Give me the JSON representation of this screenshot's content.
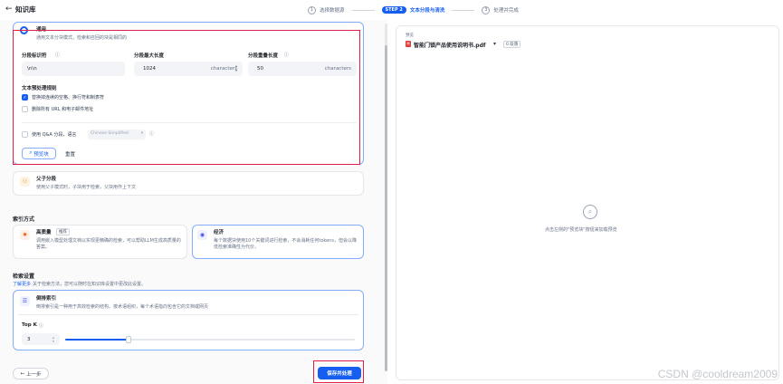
{
  "header": {
    "back_icon": "arrow-left-icon",
    "title": "知识库",
    "steps": [
      {
        "num": "1",
        "label": "选择数据源"
      },
      {
        "badge": "STEP 2",
        "label": "文本分段与清洗"
      },
      {
        "num": "3",
        "label": "处理并完成"
      }
    ]
  },
  "general_mode": {
    "title": "通用",
    "desc": "通用文本分块模式，检索和召回的块是相同的",
    "delimiter_label": "分段标识符",
    "delimiter_value": "\\n\\n",
    "max_len_label": "分段最大长度",
    "max_len_value": "1024",
    "max_len_unit": "characters",
    "overlap_label": "分段重叠长度",
    "overlap_value": "50",
    "overlap_unit": "characters",
    "preprocess_title": "文本预处理规则",
    "rule1": "替换掉连续的空格、换行符和制表符",
    "rule2": "删除所有 URL 和电子邮件地址",
    "qa_label": "使用 Q&A 分段，语言",
    "qa_lang": "Chinese Simplified",
    "preview_button": "预览块",
    "reset_button": "重置"
  },
  "parent_child": {
    "title": "父子分段",
    "desc": "使用父子模式时，子块用于检索，父块用作上下文"
  },
  "index_method": {
    "section_title": "索引方式",
    "high_quality_title": "高质量",
    "high_quality_badge": "推荐",
    "high_quality_desc": "调用嵌入模型处理文档以实现更精确的检索，可以帮助LLM生成高质量的答案。",
    "economy_title": "经济",
    "economy_desc": "每个数据块使用10个关键词进行检索，不会消耗任何tokens，但会以降低检索准确性为代价。"
  },
  "retrieval": {
    "section_title": "检索设置",
    "learn_more_link": "了解更多",
    "learn_more_rest": "关于检索方法，您可以随时在知识库设置中更改此设置。",
    "inverted_title": "倒排索引",
    "inverted_desc": "倒排索引是一种用于高效检索的结构。按术语组织，每个术语指向包含它的文档或网页",
    "topk_label": "Top K",
    "topk_value": "3",
    "topk_fraction": 0.22
  },
  "footer": {
    "prev_button": "上一步",
    "save_button": "保存并处理"
  },
  "preview": {
    "small_label": "预览",
    "file_name": "智能门锁产品使用说明书.pdf",
    "chunk_badge": "0 段落",
    "empty_text": "点击左侧的\"预览块\"按钮来加载预览"
  },
  "watermark": "CSDN @cooldream2009",
  "colors": {
    "accent": "#155eef",
    "highlight_border": "#e11d48",
    "pdf_red": "#e03e3e"
  }
}
